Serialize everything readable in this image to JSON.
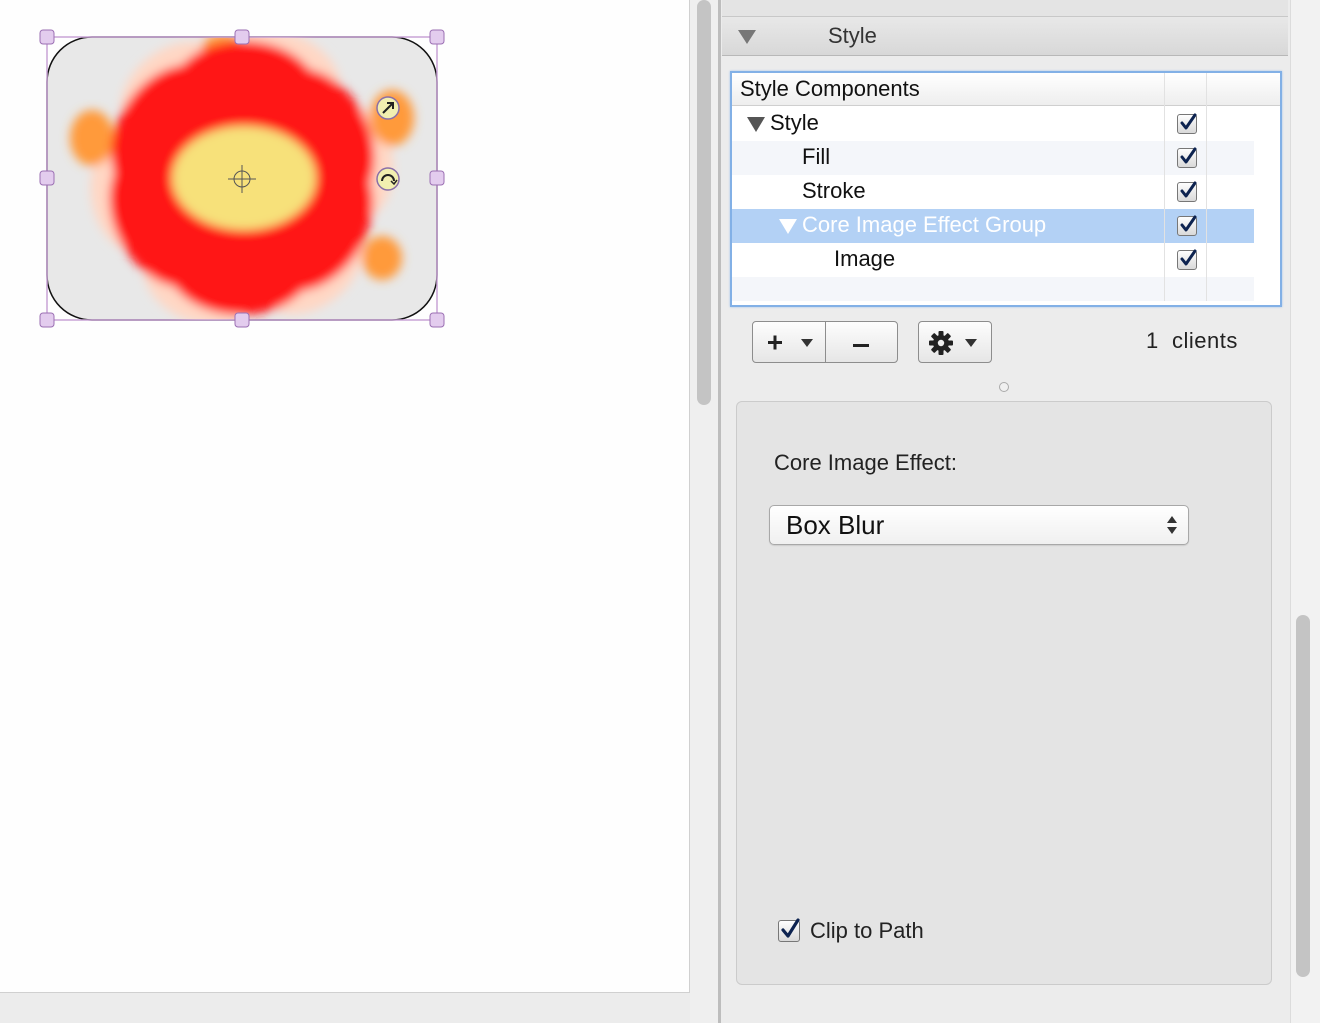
{
  "inspector": {
    "section_title": "Style",
    "table": {
      "header": "Style Components",
      "rows": [
        {
          "label": "Style",
          "expanded": true,
          "checked": true
        },
        {
          "label": "Fill",
          "checked": true
        },
        {
          "label": "Stroke",
          "checked": true
        },
        {
          "label": "Core Image Effect Group",
          "expanded": true,
          "checked": true,
          "selected": true
        },
        {
          "label": "Image",
          "checked": true
        }
      ]
    },
    "toolbar": {
      "add_icon": "plus-icon",
      "remove_icon": "minus-icon",
      "action_icon": "gear-icon"
    },
    "clients_count": "1",
    "clients_label": "clients",
    "effect": {
      "label": "Core Image Effect:",
      "selected": "Box Blur"
    },
    "clip_to_path": {
      "label": "Clip to Path",
      "checked": true
    }
  },
  "canvas": {
    "shape_icon": "flower-image",
    "colors": {
      "petal": "#ff1a1a",
      "center": "#f7e17a",
      "selection": "#c9a3d6",
      "highlight_row": "#b3d1f5"
    }
  }
}
